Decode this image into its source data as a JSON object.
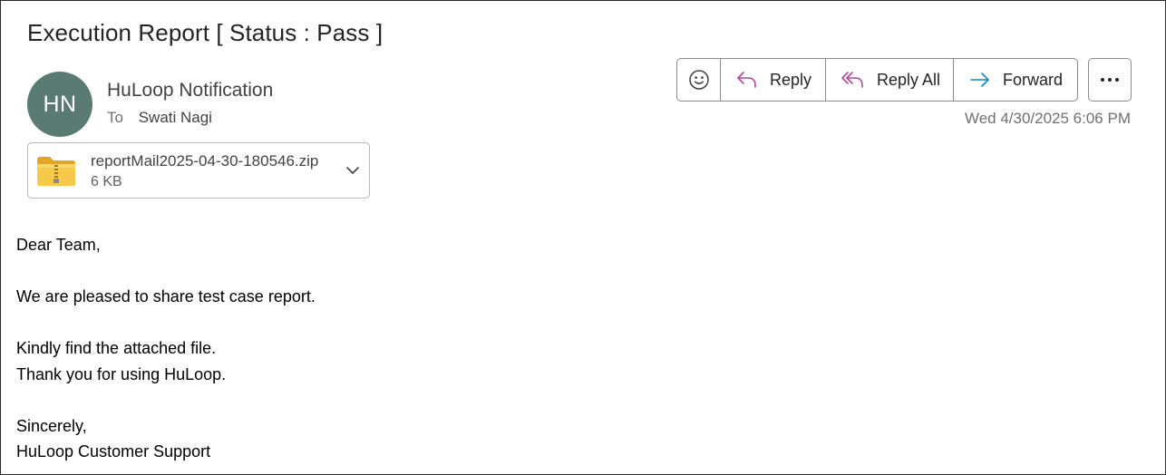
{
  "message": {
    "subject": "Execution Report [ Status : Pass ]",
    "avatar_initials": "HN",
    "sender_name": "HuLoop Notification",
    "to_label": "To",
    "to_name": "Swati Nagi",
    "timestamp": "Wed 4/30/2025 6:06 PM"
  },
  "actions": {
    "reply_label": "Reply",
    "reply_all_label": "Reply All",
    "forward_label": "Forward"
  },
  "attachment": {
    "file_name": "reportMail2025-04-30-180546.zip",
    "file_size": "6 KB",
    "icon": "zip-folder-icon"
  },
  "body": {
    "greeting": "Dear Team,",
    "line1": "We are pleased to share test case report.",
    "line2": "Kindly find the attached file.",
    "line3": "Thank you for using HuLoop.",
    "closing": "Sincerely,",
    "signature": "HuLoop Customer Support"
  },
  "colors": {
    "avatar_bg": "#5a7b71",
    "reply_icon": "#b0479a",
    "forward_icon": "#1a86c7",
    "border": "#8a8a8a"
  }
}
